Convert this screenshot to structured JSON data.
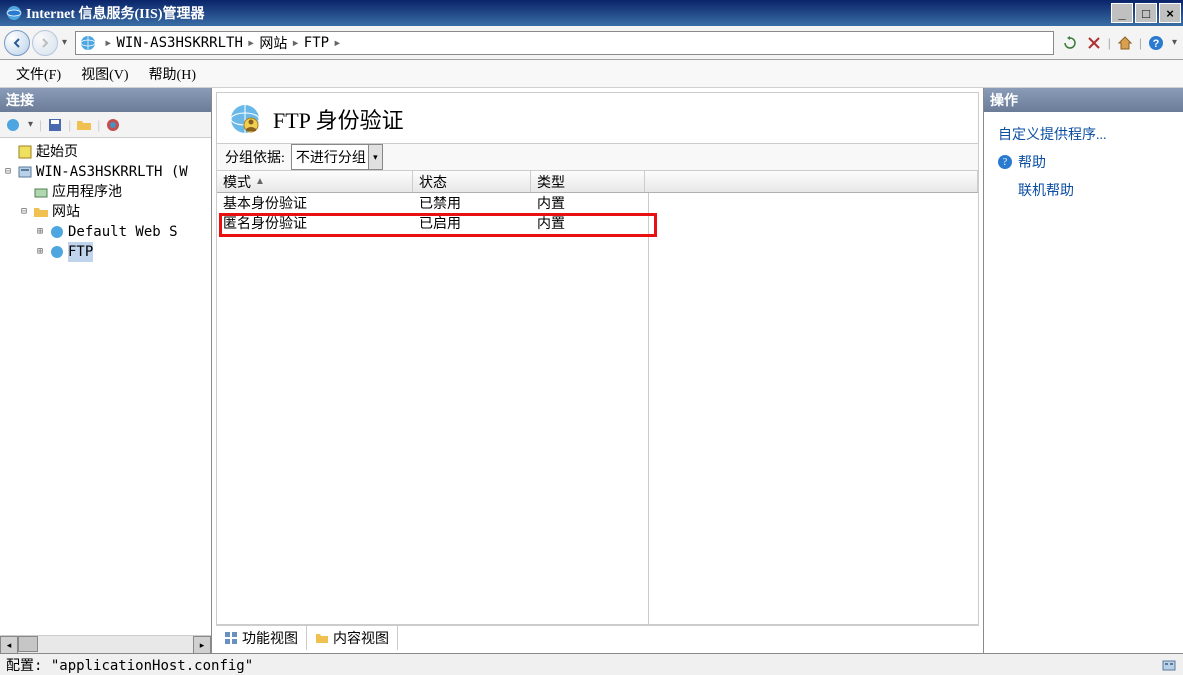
{
  "window": {
    "title": "Internet 信息服务(IIS)管理器"
  },
  "breadcrumb": {
    "server": "WIN-AS3HSKRRLTH",
    "sites": "网站",
    "site": "FTP"
  },
  "menus": {
    "file": "文件(F)",
    "view": "视图(V)",
    "help": "帮助(H)"
  },
  "connections": {
    "title": "连接",
    "start_page": "起始页",
    "server_node": "WIN-AS3HSKRRLTH (W",
    "app_pools": "应用程序池",
    "sites": "网站",
    "default_site": "Default Web S",
    "ftp_site": "FTP"
  },
  "content": {
    "heading": "FTP 身份验证",
    "group_label": "分组依据:",
    "group_value": "不进行分组",
    "columns": {
      "mode": "模式",
      "status": "状态",
      "type": "类型"
    },
    "rows": [
      {
        "mode": "基本身份验证",
        "status": "已禁用",
        "type": "内置"
      },
      {
        "mode": "匿名身份验证",
        "status": "已启用",
        "type": "内置"
      }
    ],
    "features_view": "功能视图",
    "content_view": "内容视图"
  },
  "actions": {
    "title": "操作",
    "custom_providers": "自定义提供程序...",
    "help": "帮助",
    "online_help": "联机帮助"
  },
  "status": {
    "config_label": "配置:",
    "config_value": "\"applicationHost.config\""
  }
}
